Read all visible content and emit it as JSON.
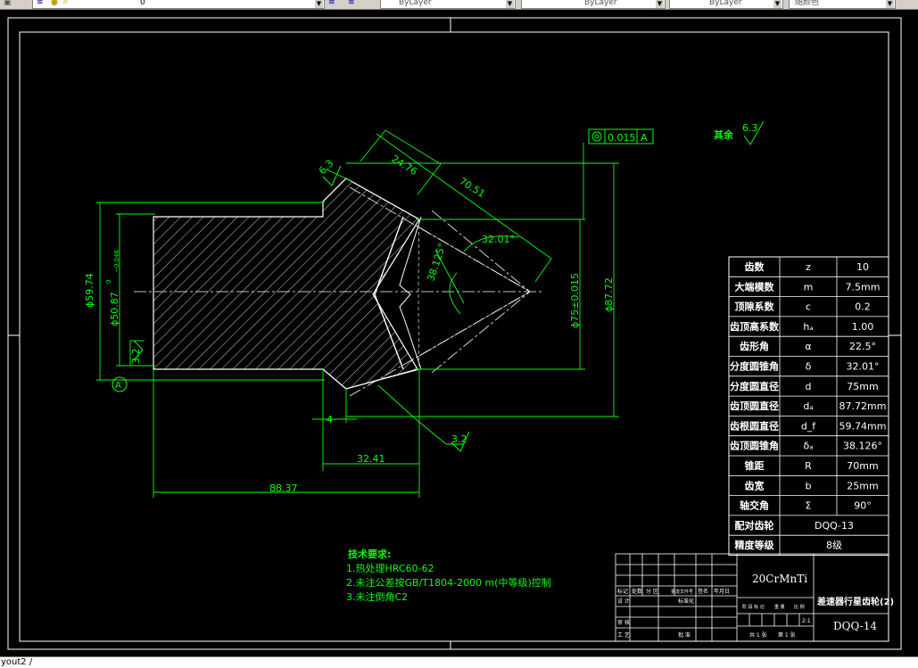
{
  "toolbar": {
    "layer_name": "0",
    "color": "ByLayer",
    "linetype": "ByLayer",
    "lineweight": "ByLayer",
    "plotstyle": "随颜色"
  },
  "status": {
    "layout_tab": "yout2 /"
  },
  "drawing": {
    "tolerance_frame": [
      "0.015",
      "A"
    ],
    "other_roughness": "其余",
    "roughness_63": "6.3",
    "roughness_32": "3.2",
    "datum": "A",
    "dims": {
      "d_5974": "ϕ59.74",
      "d_5087": "ϕ50.87",
      "d_5087_upper": "0",
      "d_5087_lower": "−0.046",
      "d_75": "ϕ75±0.015",
      "d_8772": "ϕ87.72",
      "len_2476": "24.76",
      "len_7051": "70.51",
      "ang_3201": "32.01°",
      "ang_38125": "38.125°",
      "len_4": "4",
      "len_3241": "32.41",
      "len_8837": "88.37"
    },
    "tech_req": {
      "title": "技术要求:",
      "items": [
        "1.热处理HRC60-62",
        "2.未注公差按GB/T1804-2000 m(中等级)控制",
        "3.未注倒角C2"
      ]
    }
  },
  "params": [
    [
      "齿数",
      "z",
      "10"
    ],
    [
      "大端模数",
      "m",
      "7.5mm"
    ],
    [
      "顶隙系数",
      "c",
      "0.2"
    ],
    [
      "齿顶高系数",
      "hₐ",
      "1.00"
    ],
    [
      "齿形角",
      "α",
      "22.5°"
    ],
    [
      "分度圆锥角",
      "δ",
      "32.01°"
    ],
    [
      "分度圆直径",
      "d",
      "75mm"
    ],
    [
      "齿顶圆直径",
      "dₐ",
      "87.72mm"
    ],
    [
      "齿根圆直径",
      "d_f",
      "59.74mm"
    ],
    [
      "齿顶圆锥角",
      "δₐ",
      "38.126°"
    ],
    [
      "锥距",
      "R",
      "70mm"
    ],
    [
      "齿宽",
      "b",
      "25mm"
    ],
    [
      "轴交角",
      "Σ",
      "90°"
    ]
  ],
  "mating": [
    "配对齿轮",
    "DQQ-13"
  ],
  "accuracy": [
    "精度等级",
    "8级"
  ],
  "title_block": {
    "material": "20CrMnTi",
    "part_name": "差速器行星齿轮(2)",
    "drawing_no": "DQQ-14",
    "scale": "2:1",
    "row_labels": [
      "标记",
      "处数",
      "分 区",
      "更改文件号",
      "签名",
      "年月日"
    ],
    "stage_labels": [
      "阶 段 标 记",
      "重 量",
      "比 例"
    ],
    "design": "设 计",
    "standardize": "标准化",
    "review": "审 核",
    "process": "工 艺",
    "approve": "批 准",
    "sheets": "共 1 张",
    "sheet": "第 1 张"
  }
}
